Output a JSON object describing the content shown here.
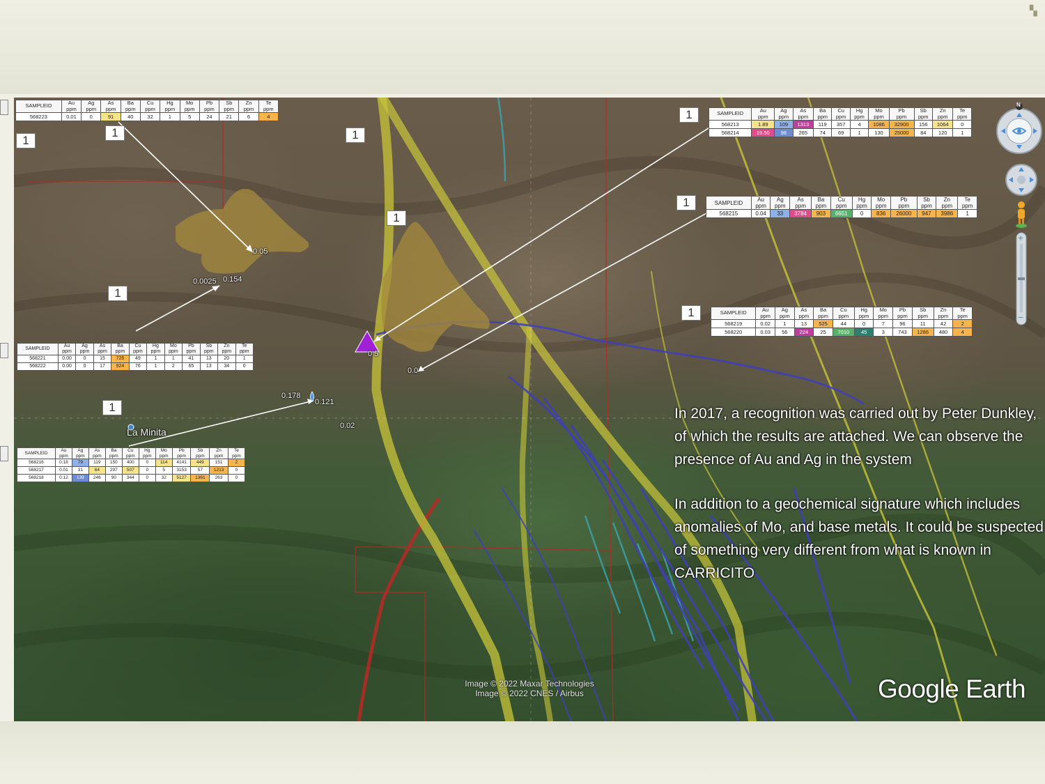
{
  "map": {
    "place_label": "La Minita",
    "credit_line1": "Image © 2022 Maxar Technologies",
    "credit_line2": "Image © 2022 CNES / Airbus",
    "logo_text": "Google Earth",
    "value_labels": [
      "0.05",
      "0.0025",
      "0.154",
      "0.178",
      "0.121",
      "0.02",
      "0.0",
      "0.5"
    ],
    "sample_markers": [
      "1",
      "1",
      "1",
      "1",
      "1",
      "1",
      "1",
      "1",
      "1"
    ],
    "controls": {
      "compass_letter": "N",
      "zoom_in": "+",
      "zoom_out": "−"
    },
    "colors": {
      "yellow_structure": "#c8c43a",
      "blue_structure": "#3f3fb8",
      "red_boundary": "#b52a25",
      "cyan_structure": "#3aa6b0",
      "alteration_zone": "#a58a3c",
      "marker": "#a020d8"
    }
  },
  "tables": {
    "headers": [
      [
        "SAMPLEID",
        ""
      ],
      [
        "Au",
        "ppm"
      ],
      [
        "Ag",
        "ppm"
      ],
      [
        "As",
        "ppm"
      ],
      [
        "Ba",
        "ppm"
      ],
      [
        "Cu",
        "ppm"
      ],
      [
        "Hg",
        "ppm"
      ],
      [
        "Mo",
        "ppm"
      ],
      [
        "Pb",
        "ppm"
      ],
      [
        "Sb",
        "ppm"
      ],
      [
        "Zn",
        "ppm"
      ],
      [
        "Te",
        "ppm"
      ]
    ],
    "t1": [
      [
        "568223",
        "0.01",
        "0",
        "91",
        "40",
        "32",
        "1",
        "5",
        "24",
        "21",
        "6",
        "4"
      ]
    ],
    "t2": [
      [
        "568213",
        "1.89",
        "109",
        "1313",
        "119",
        "357",
        "4",
        "1086",
        "32900",
        "156",
        "1064",
        "0"
      ],
      [
        "568214",
        "19.50",
        "98",
        "265",
        "74",
        "69",
        "1",
        "130",
        "25000",
        "84",
        "120",
        "1"
      ]
    ],
    "t3": [
      [
        "568215",
        "0.04",
        "33",
        "3784",
        "903",
        "6651",
        "0",
        "836",
        "26000",
        "947",
        "3986",
        "1"
      ]
    ],
    "t4": [
      [
        "568219",
        "0.02",
        "1",
        "13",
        "525",
        "44",
        "0",
        "7",
        "96",
        "11",
        "42",
        "2"
      ],
      [
        "568220",
        "0.03",
        "56",
        "224",
        "25",
        "7010",
        "45",
        "3",
        "743",
        "1286",
        "480",
        "4"
      ]
    ],
    "t5": [
      [
        "568221",
        "0.00",
        "0",
        "15",
        "726",
        "49",
        "1",
        "1",
        "41",
        "13",
        "20",
        "1"
      ],
      [
        "568222",
        "0.00",
        "0",
        "17",
        "924",
        "76",
        "1",
        "2",
        "65",
        "13",
        "34",
        "0"
      ]
    ],
    "t6": [
      [
        "568216",
        "0.18",
        "79",
        "119",
        "150",
        "400",
        "0",
        "114",
        "4141",
        "449",
        "151",
        "2"
      ],
      [
        "568217",
        "0.01",
        "31",
        "64",
        "297",
        "507",
        "0",
        "5",
        "3153",
        "57",
        "1213",
        "0"
      ],
      [
        "568218",
        "0.12",
        "139",
        "246",
        "90",
        "344",
        "0",
        "32",
        "5127",
        "1361",
        "263",
        "0"
      ]
    ]
  },
  "note": {
    "paragraph1": "In 2017, a recognition was carried out by Peter Dunkley, of which the results are attached. We can observe the presence of Au and Ag in the system",
    "paragraph2": "In addition to a geochemical signature which includes anomalies of Mo, and base metals. It could be suspected of something very different from what is known in CARRICITO"
  }
}
